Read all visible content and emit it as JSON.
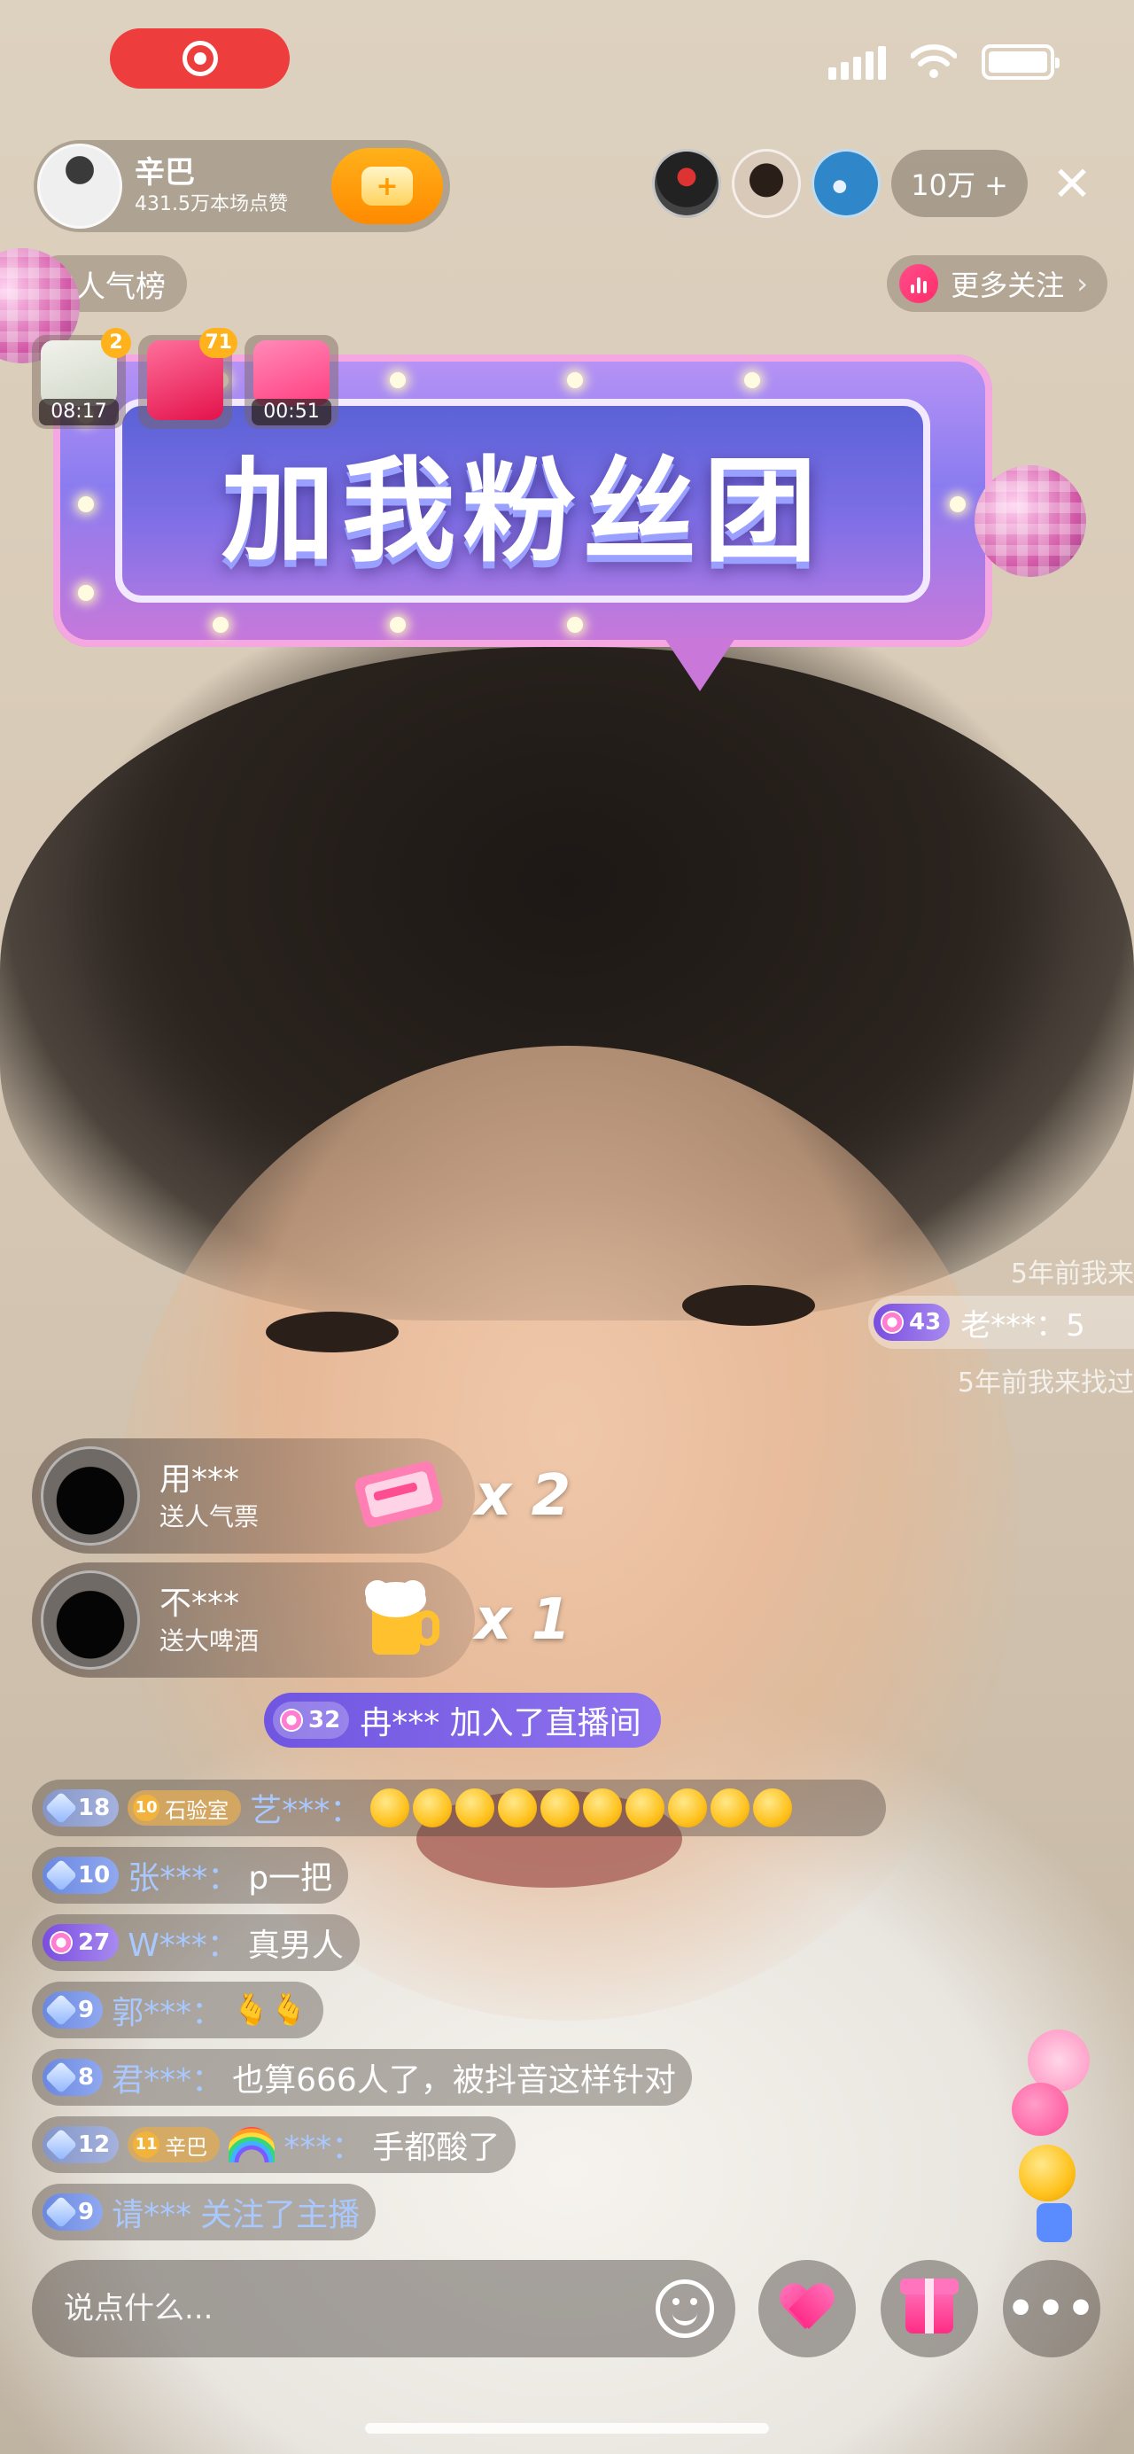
{
  "status_bar": {
    "recording": true
  },
  "host": {
    "name": "辛巴",
    "likes": "431.5万本场点赞"
  },
  "viewers": {
    "count": "10万 +"
  },
  "rank": {
    "label": "人气榜"
  },
  "more_follow": {
    "label": "更多关注",
    "chevron": "›"
  },
  "activity_tiles": [
    {
      "badge": "2",
      "time": "08:17"
    },
    {
      "badge": "71",
      "time": ""
    },
    {
      "badge": "",
      "time": "00:51"
    }
  ],
  "fan_banner": {
    "title": "加我粉丝团"
  },
  "side_comments": {
    "ghost_top": "5年前我来",
    "level": "43",
    "text": "老***：5",
    "ghost_bottom": "5年前我来找过"
  },
  "gifts": [
    {
      "user": "用***",
      "desc": "送人气票",
      "count": "x 2",
      "icon": "ticket-icon"
    },
    {
      "user": "不***",
      "desc": "送大啤酒",
      "count": "x 1",
      "icon": "beer-icon"
    }
  ],
  "join_notice": {
    "level": "32",
    "text": "冉*** 加入了直播间"
  },
  "chat": [
    {
      "level": "18",
      "fan_num": "10",
      "fan_name": "石验室",
      "user": "艺***：",
      "message": "",
      "emoji_count": 10,
      "style": "slate"
    },
    {
      "level": "10",
      "user": "张***：",
      "message": "p一把",
      "style": "blue"
    },
    {
      "level": "27",
      "user": "W***：",
      "message": "真男人",
      "style": "purple"
    },
    {
      "level": "9",
      "user": "郭***：",
      "message": "",
      "style": "blue",
      "hands": "🫰🫰"
    },
    {
      "level": "8",
      "user": "君***：",
      "message": "也算666人了，被抖音这样针对",
      "style": "blue"
    },
    {
      "level": "12",
      "fan_num": "11",
      "fan_name": "辛巴",
      "user": "***：",
      "message": "手都酸了",
      "style": "slate",
      "rainbow": true
    },
    {
      "level": "9",
      "user": "请***",
      "message": "关注了主播",
      "style": "blue"
    }
  ],
  "input": {
    "placeholder": "说点什么..."
  },
  "colors": {
    "accent": "#ff2d84",
    "record": "#ee3d3d",
    "follow": "#ff9a00",
    "level_purple": "#7a4ddf",
    "level_blue": "#6b88e0"
  }
}
